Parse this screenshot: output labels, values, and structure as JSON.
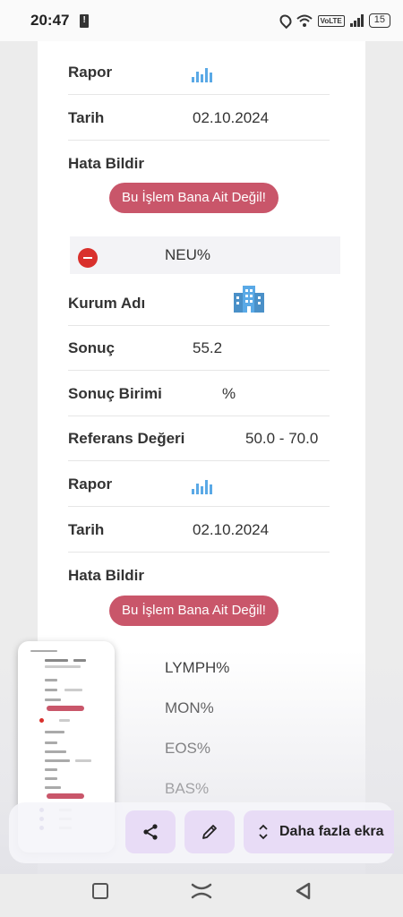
{
  "status_bar": {
    "time": "20:47",
    "network": "VoLTE",
    "battery": "15"
  },
  "record1": {
    "rapor_label": "Rapor",
    "tarih_label": "Tarih",
    "tarih_value": "02.10.2024",
    "hata_label": "Hata Bildir",
    "error_button": "Bu İşlem Bana Ait Değil!"
  },
  "record2": {
    "title": "NEU%",
    "kurum_label": "Kurum Adı",
    "sonuc_label": "Sonuç",
    "sonuc_value": "55.2",
    "birim_label": "Sonuç Birimi",
    "birim_value": "%",
    "referans_label": "Referans Değeri",
    "referans_value": "50.0 - 70.0",
    "rapor_label": "Rapor",
    "tarih_label": "Tarih",
    "tarih_value": "02.10.2024",
    "hata_label": "Hata Bildir",
    "error_button": "Bu İşlem Bana Ait Değil!"
  },
  "collapsed_items": [
    "LYMPH%",
    "MON%",
    "EOS%",
    "BAS%"
  ],
  "toolbar": {
    "share_icon": "share-icon",
    "edit_icon": "pencil-icon",
    "more_label": "Daha fazla ekra"
  },
  "navbar": {
    "recent": "square-icon",
    "home": "home-icon",
    "back": "back-triangle-icon"
  },
  "colors": {
    "error_button": "#c9566a",
    "minus": "#d9302c",
    "chart_icon": "#5aa9e6",
    "toolbar_button": "#e8dcf6"
  }
}
